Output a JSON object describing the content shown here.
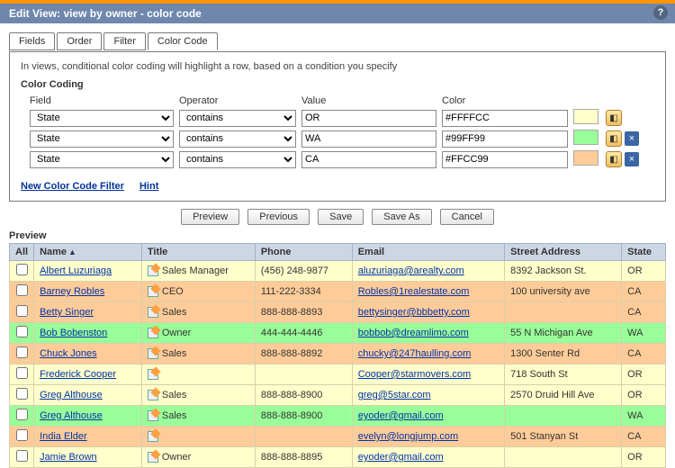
{
  "header": {
    "title": "Edit View: view by owner - color code",
    "help": "?"
  },
  "tabs": [
    {
      "label": "Fields",
      "active": false
    },
    {
      "label": "Order",
      "active": false
    },
    {
      "label": "Filter",
      "active": false
    },
    {
      "label": "Color Code",
      "active": true
    }
  ],
  "panel": {
    "description": "In views, conditional color coding will highlight a row, based on a condition you specify",
    "section": "Color Coding",
    "head": {
      "field": "Field",
      "operator": "Operator",
      "value": "Value",
      "color": "Color"
    },
    "rules": [
      {
        "field": "State",
        "operator": "contains",
        "value": "OR",
        "color": "#FFFFCC",
        "deletable": false
      },
      {
        "field": "State",
        "operator": "contains",
        "value": "WA",
        "color": "#99FF99",
        "deletable": true
      },
      {
        "field": "State",
        "operator": "contains",
        "value": "CA",
        "color": "#FFCC99",
        "deletable": true
      }
    ],
    "links": {
      "new_filter": "New Color Code Filter",
      "hint": "Hint"
    }
  },
  "buttons": {
    "preview": "Preview",
    "previous": "Previous",
    "save": "Save",
    "saveas": "Save As",
    "cancel": "Cancel"
  },
  "preview": {
    "label": "Preview",
    "columns": {
      "all": "All",
      "name": "Name",
      "title": "Title",
      "phone": "Phone",
      "email": "Email",
      "address": "Street Address",
      "state": "State"
    },
    "sort_col": "name",
    "rows": [
      {
        "name": "Albert Luzuriaga",
        "title": "Sales Manager",
        "phone": "(456) 248-9877",
        "email": "aluzuriaga@arealty.com",
        "address": "8392 Jackson St.",
        "state": "OR",
        "cls": "row-yellow"
      },
      {
        "name": "Barney Robles",
        "title": "CEO",
        "phone": "111-222-3334",
        "email": "Robles@1realestate.com",
        "address": "100 university ave",
        "state": "CA",
        "cls": "row-orange"
      },
      {
        "name": "Betty Singer",
        "title": "Sales",
        "phone": "888-888-8893",
        "email": "bettysinger@bbbetty.com",
        "address": "",
        "state": "CA",
        "cls": "row-orange"
      },
      {
        "name": "Bob Bobenston",
        "title": "Owner",
        "phone": "444-444-4446",
        "email": "bobbob@dreamlimo.com",
        "address": "55 N Michigan Ave",
        "state": "WA",
        "cls": "row-green"
      },
      {
        "name": "Chuck Jones",
        "title": "Sales",
        "phone": "888-888-8892",
        "email": "chucky@247haulling.com",
        "address": "1300 Senter Rd",
        "state": "CA",
        "cls": "row-orange"
      },
      {
        "name": "Frederick Cooper",
        "title": "",
        "phone": "",
        "email": "Cooper@starmovers.com",
        "address": "718 South St",
        "state": "OR",
        "cls": "row-yellow"
      },
      {
        "name": "Greg Althouse",
        "title": "Sales",
        "phone": "888-888-8900",
        "email": "greg@5star.com",
        "address": "2570 Druid Hill Ave",
        "state": "OR",
        "cls": "row-yellow"
      },
      {
        "name": "Greg Althouse",
        "title": "Sales",
        "phone": "888-888-8900",
        "email": "eyoder@gmail.com",
        "address": "",
        "state": "WA",
        "cls": "row-green"
      },
      {
        "name": "India Elder",
        "title": "",
        "phone": "",
        "email": "evelyn@longjump.com",
        "address": "501 Stanyan St",
        "state": "CA",
        "cls": "row-orange"
      },
      {
        "name": "Jamie Brown",
        "title": "Owner",
        "phone": "888-888-8895",
        "email": "eyoder@gmail.com",
        "address": "",
        "state": "OR",
        "cls": "row-yellow"
      }
    ]
  }
}
